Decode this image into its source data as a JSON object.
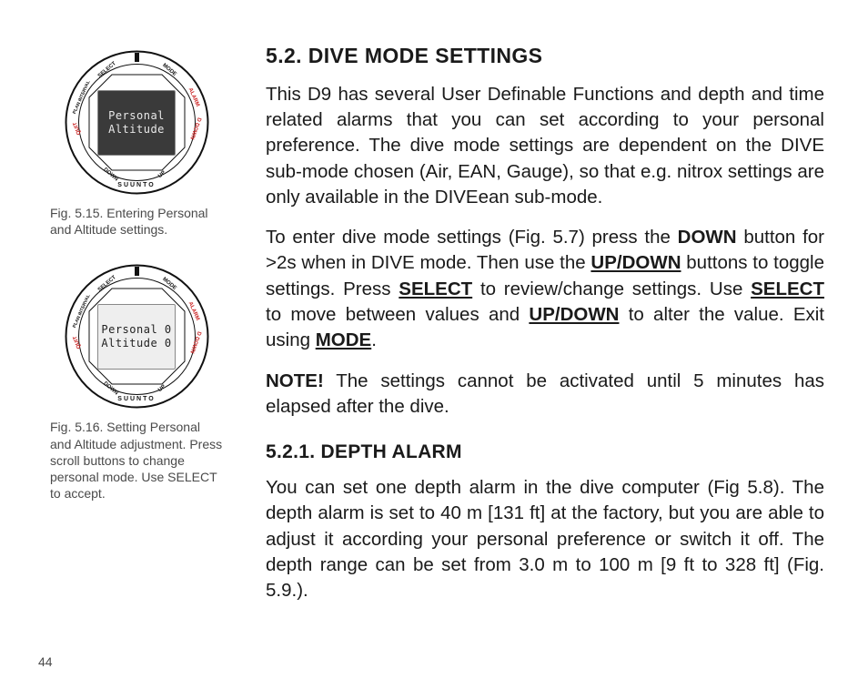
{
  "page_number": 44,
  "sidebar": {
    "fig1": {
      "line1": "Personal",
      "line2": "Altitude",
      "caption": "Fig. 5.15. Entering Personal and Altitude settings."
    },
    "fig2": {
      "line1": "Personal 0",
      "line2": "Altitude  0",
      "caption": "Fig. 5.16. Setting Personal and Altitude adjustment. Press scroll buttons to change personal mode. Use SELECT to accept."
    },
    "bezel": {
      "select": "SELECT",
      "mode": "MODE",
      "down": "DOWN",
      "up": "UP",
      "brand": "SUUNTO",
      "alarm": "ALARM",
      "d_down": "D DOWN",
      "quit": "QUIT",
      "plan_interval": "PLAN INTERVAL"
    }
  },
  "content": {
    "h2": "5.2. DIVE MODE SETTINGS",
    "p1": "This D9 has several User Definable Functions and depth and time related alarms that you can set according to your personal preference. The dive mode settings are dependent on the DIVE sub-mode chosen (Air, EAN, Gauge), so that e.g. nitrox settings are only available in the DIVEean sub-mode.",
    "p2_a": "To enter dive mode settings (Fig. 5.7) press the ",
    "p2_key_down": "DOWN",
    "p2_b": " button for >2s when in DIVE mode. Then use the ",
    "p2_key_updown1": "UP/DOWN",
    "p2_c": " buttons to toggle settings. Press ",
    "p2_key_select1": "SELECT",
    "p2_d": " to review/change settings. Use ",
    "p2_key_select2": "SELECT",
    "p2_e": " to move between values and ",
    "p2_key_updown2": "UP/DOWN",
    "p2_f": " to alter the value. Exit using ",
    "p2_key_mode": "MODE",
    "p2_g": ".",
    "note_label": "NOTE!",
    "note_text": " The settings cannot be activated until 5 minutes has elapsed after the dive.",
    "h3": "5.2.1. DEPTH ALARM",
    "p3": "You can set one depth alarm in the dive computer (Fig 5.8). The depth alarm is set to 40 m [131 ft] at the factory, but you are able to adjust it according your personal preference or switch it off. The depth range can be set from 3.0 m to 100 m [9 ft to 328 ft] (Fig. 5.9.)."
  }
}
